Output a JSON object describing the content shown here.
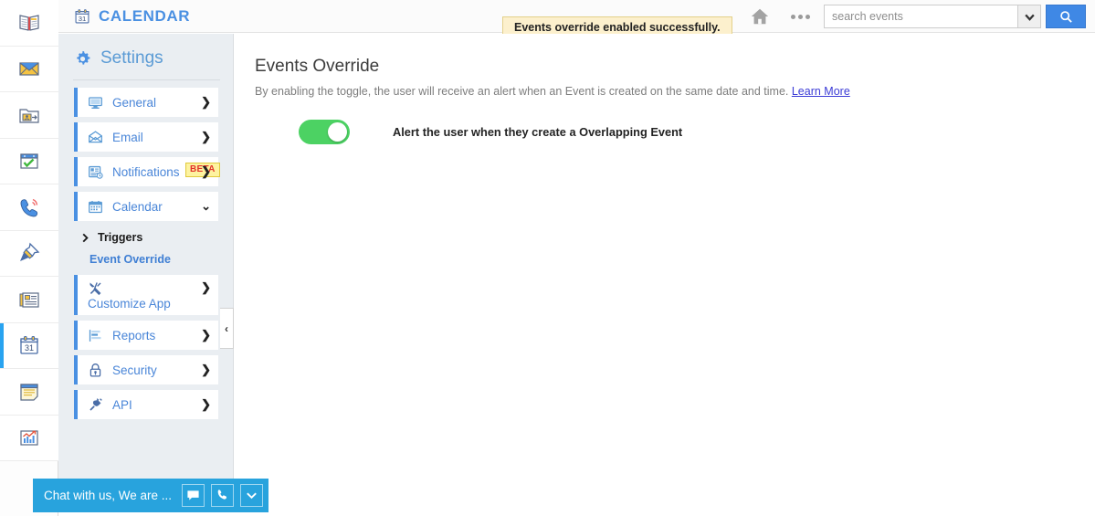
{
  "rail": {
    "items": [
      {
        "name": "book-icon",
        "label": "Knowledge Base",
        "active": false
      },
      {
        "name": "mail-icon",
        "label": "Mail",
        "active": false
      },
      {
        "name": "contacts-folder-icon",
        "label": "Contacts",
        "active": false
      },
      {
        "name": "tasks-check-icon",
        "label": "Tasks",
        "active": false
      },
      {
        "name": "phone-icon",
        "label": "Calls",
        "active": false
      },
      {
        "name": "pin-icon",
        "label": "Pinned",
        "active": false
      },
      {
        "name": "news-icon",
        "label": "Feed",
        "active": false
      },
      {
        "name": "calendar-icon",
        "label": "Calendar",
        "active": true
      },
      {
        "name": "notes-icon",
        "label": "Notes",
        "active": false
      },
      {
        "name": "analytics-icon",
        "label": "Analytics",
        "active": false
      }
    ]
  },
  "header": {
    "brand": "CALENDAR",
    "brand_icon": "calendar-31-icon",
    "toast": "Events override enabled successfully.",
    "home_icon": "home-icon",
    "more_icon": "more-dots-icon",
    "search": {
      "placeholder": "search events",
      "value": "",
      "dropdown_icon": "chevron-down-icon",
      "submit_icon": "search-icon"
    }
  },
  "settings": {
    "title": "Settings",
    "title_icon": "gear-icon",
    "items": [
      {
        "label": "General",
        "icon": "monitor-icon",
        "chevron": "❯",
        "badge": null,
        "tall": false
      },
      {
        "label": "Email",
        "icon": "envelope-open-icon",
        "chevron": "❯",
        "badge": null,
        "tall": false
      },
      {
        "label": "Notifications",
        "icon": "notification-list-icon",
        "chevron": "❯",
        "badge": "BETA",
        "tall": false
      },
      {
        "label": "Calendar",
        "icon": "calendar-grid-icon",
        "chevron": "⌄",
        "badge": null,
        "tall": false
      }
    ],
    "sub": {
      "trigger_label": "Triggers",
      "trigger_icon": "chevron-right-icon",
      "active_link": "Event Override"
    },
    "items_lower": [
      {
        "label": "Customize App",
        "icon": "tools-icon",
        "chevron": "❯",
        "badge": null,
        "tall": true
      },
      {
        "label": "Reports",
        "icon": "report-bars-icon",
        "chevron": "❯",
        "badge": null,
        "tall": false
      },
      {
        "label": "Security",
        "icon": "lock-icon",
        "chevron": "❯",
        "badge": null,
        "tall": false
      },
      {
        "label": "API",
        "icon": "plug-icon",
        "chevron": "❯",
        "badge": null,
        "tall": false
      }
    ]
  },
  "collapse": {
    "icon": "chevron-left-icon",
    "label": "‹"
  },
  "main": {
    "title": "Events Override",
    "description": "By enabling the toggle, the user will receive an alert when an Event is created on the same date and time.",
    "learn_more": "Learn More",
    "toggle": {
      "state": "on",
      "color": "#4cd263",
      "label": "Alert the user when they create a Overlapping Event"
    }
  },
  "chat": {
    "text": "Chat with us, We are ...",
    "buttons": [
      {
        "name": "chat-message-icon"
      },
      {
        "name": "chat-phone-icon"
      },
      {
        "name": "chat-collapse-icon"
      }
    ]
  },
  "colors": {
    "brand_blue": "#4a90e2",
    "accent_blue": "#29a3f0",
    "toggle_green": "#4cd263",
    "toast_bg": "#fcf0cd",
    "chat_blue": "#28a3dd"
  }
}
